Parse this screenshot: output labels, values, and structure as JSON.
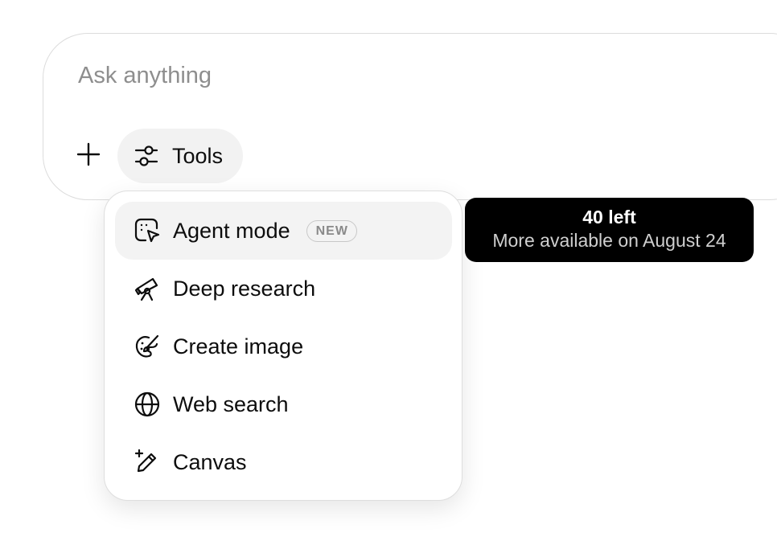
{
  "composer": {
    "placeholder": "Ask anything",
    "value": "",
    "plus_icon": "plus-icon",
    "tools_label": "Tools",
    "tools_icon": "sliders-icon"
  },
  "menu": {
    "items": [
      {
        "label": "Agent mode",
        "icon": "agent-cursor-icon",
        "badge": "NEW",
        "highlighted": true
      },
      {
        "label": "Deep research",
        "icon": "telescope-icon"
      },
      {
        "label": "Create image",
        "icon": "palette-icon"
      },
      {
        "label": "Web search",
        "icon": "globe-icon"
      },
      {
        "label": "Canvas",
        "icon": "pencil-sparkle-icon"
      }
    ]
  },
  "tooltip": {
    "title": "40 left",
    "subtitle": "More available on August 24"
  },
  "colors": {
    "tooltip_bg": "#000000",
    "highlight_bg": "#f3f3f3",
    "tools_bg": "#f2f2f2",
    "placeholder": "#8e8e8e"
  }
}
